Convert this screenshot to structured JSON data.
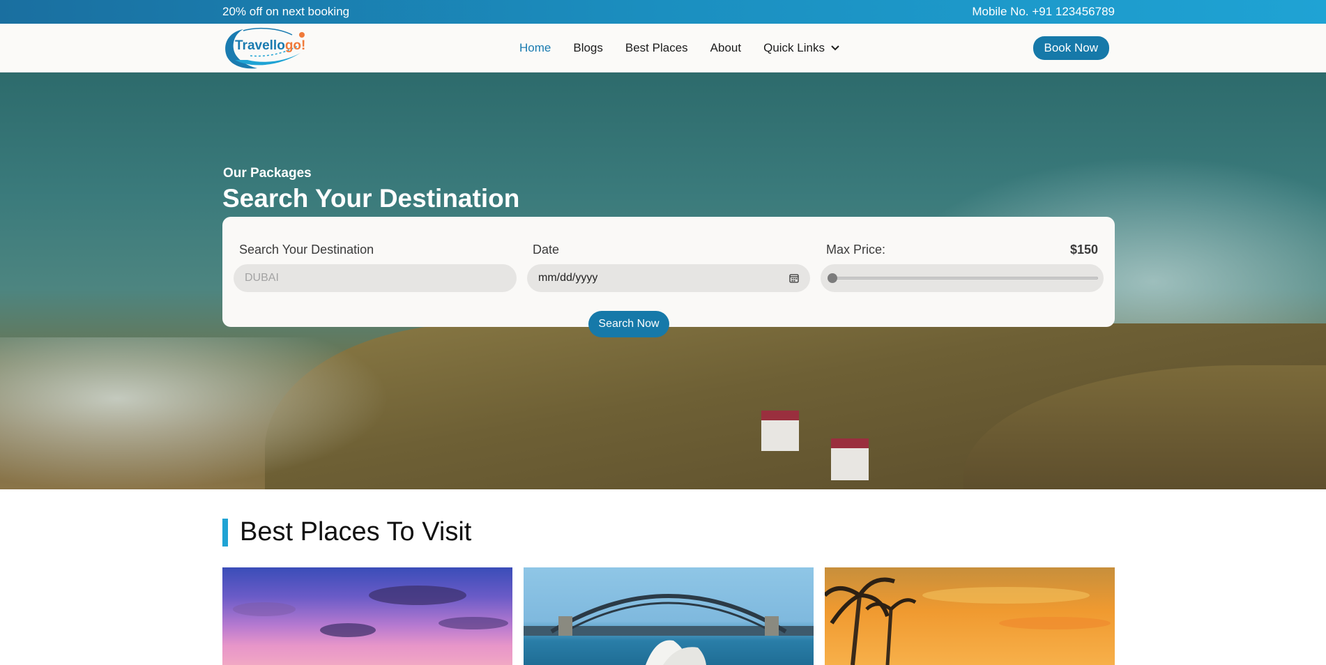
{
  "topbar": {
    "offer_text": "20% off on next booking",
    "mobile_text": "Mobile No. +91 123456789"
  },
  "brand": {
    "logo_text_main": "Travello",
    "logo_text_accent": "go!"
  },
  "nav": {
    "items": [
      {
        "label": "Home",
        "active": true
      },
      {
        "label": "Blogs",
        "active": false
      },
      {
        "label": "Best Places",
        "active": false
      },
      {
        "label": "About",
        "active": false
      },
      {
        "label": "Quick Links",
        "active": false,
        "icon": "chevron-down-icon"
      }
    ],
    "book_label": "Book Now"
  },
  "hero": {
    "subtitle": "Our Packages",
    "title": "Search Your Destination"
  },
  "search": {
    "destination_label": "Search Your Destination",
    "destination_placeholder": "DUBAI",
    "date_label": "Date",
    "date_placeholder": "mm/dd/yyyy",
    "date_icon": "calendar-icon",
    "price_label": "Max Price:",
    "price_value": "$150",
    "slider_fraction": 0.0,
    "button_label": "Search Now"
  },
  "places": {
    "heading": "Best Places To Visit"
  },
  "colors": {
    "primary": "#1679a9",
    "accent": "#1fa3d4",
    "logo_orange": "#f07a3a"
  }
}
